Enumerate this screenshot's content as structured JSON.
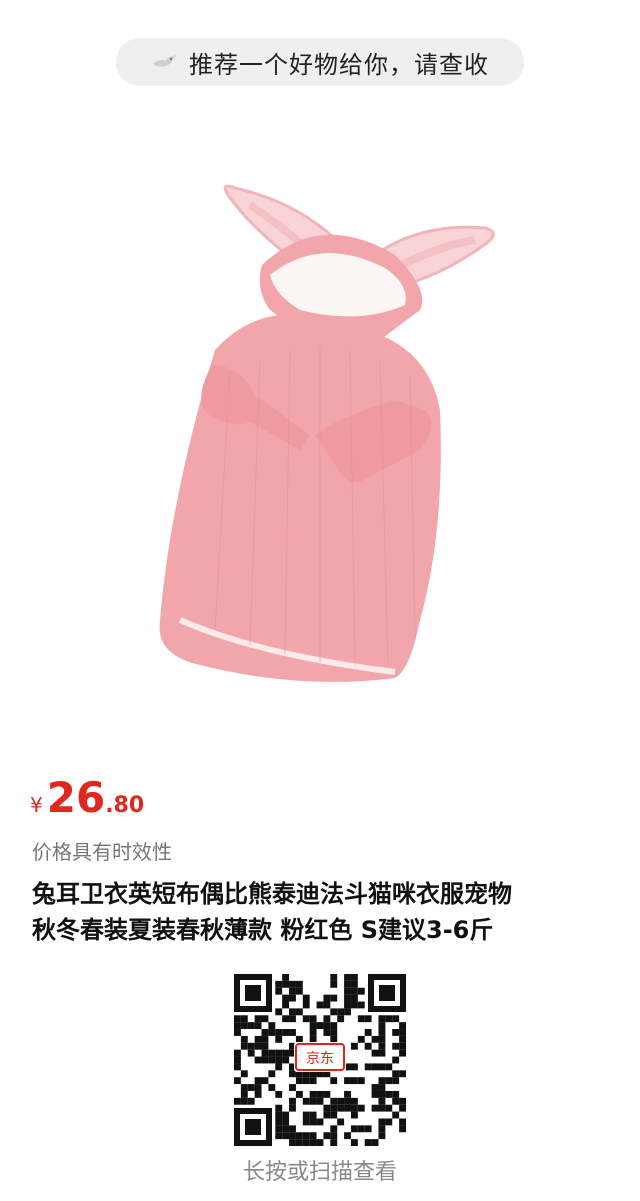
{
  "banner": {
    "text": "推荐一个好物给你，请查收",
    "icon": "bird-icon"
  },
  "product": {
    "image": "pink-bunny-ear-pet-hoodie",
    "price": {
      "currency": "¥",
      "integer": "26",
      "decimal": ".80"
    },
    "price_note": "价格具有时效性",
    "title_lines": [
      "兔耳卫衣英短布偶比熊泰迪法斗猫咪衣服宠物",
      "秋冬春装夏装春秋薄款 粉红色 S建议3-6斤"
    ]
  },
  "qr": {
    "center_label": "京东"
  },
  "scan_hint": "长按或扫描查看",
  "colors": {
    "price": "#e0281f",
    "banner_bg": "#efefef",
    "hoodie": "#f2a6ab",
    "hint": "#888888"
  }
}
